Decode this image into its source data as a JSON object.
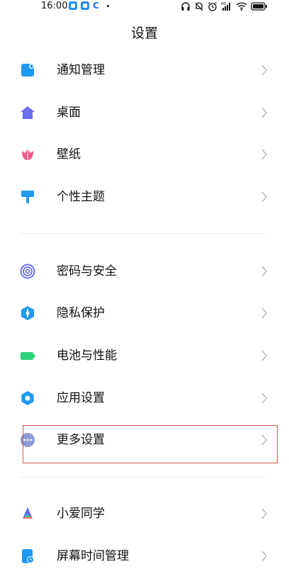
{
  "status_bar": {
    "time": "16:00",
    "notification_icons": [
      "app-square-icon",
      "app-square-icon",
      "c-app-icon",
      "dot-icon"
    ],
    "system_icons": [
      "headphone-icon",
      "mute-bell-icon",
      "alarm-icon",
      "hd-signal-icon",
      "wifi-icon",
      "battery-icon"
    ]
  },
  "header": {
    "title": "设置"
  },
  "settings": {
    "group1": [
      {
        "label": "通知管理",
        "icon": "notification-icon",
        "color": "#1e9bf0"
      },
      {
        "label": "桌面",
        "icon": "home-icon",
        "color": "#6b6ff0"
      },
      {
        "label": "壁纸",
        "icon": "tulip-icon",
        "color": "#f05a8a"
      },
      {
        "label": "个性主题",
        "icon": "paint-roller-icon",
        "color": "#1e9bf0"
      }
    ],
    "group2": [
      {
        "label": "密码与安全",
        "icon": "fingerprint-icon",
        "color": "#6b6ff0"
      },
      {
        "label": "隐私保护",
        "icon": "privacy-shield-icon",
        "color": "#1e9bf0"
      },
      {
        "label": "电池与性能",
        "icon": "battery-icon",
        "color": "#2fd17a"
      },
      {
        "label": "应用设置",
        "icon": "gear-icon",
        "color": "#1e9bf0"
      },
      {
        "label": "更多设置",
        "icon": "more-dots-icon",
        "color": "#8e9bd4"
      }
    ],
    "group3": [
      {
        "label": "小爱同学",
        "icon": "xiaoai-icon",
        "color": "#3d7bf5"
      },
      {
        "label": "屏幕时间管理",
        "icon": "screen-time-icon",
        "color": "#1e9bf0"
      }
    ]
  }
}
